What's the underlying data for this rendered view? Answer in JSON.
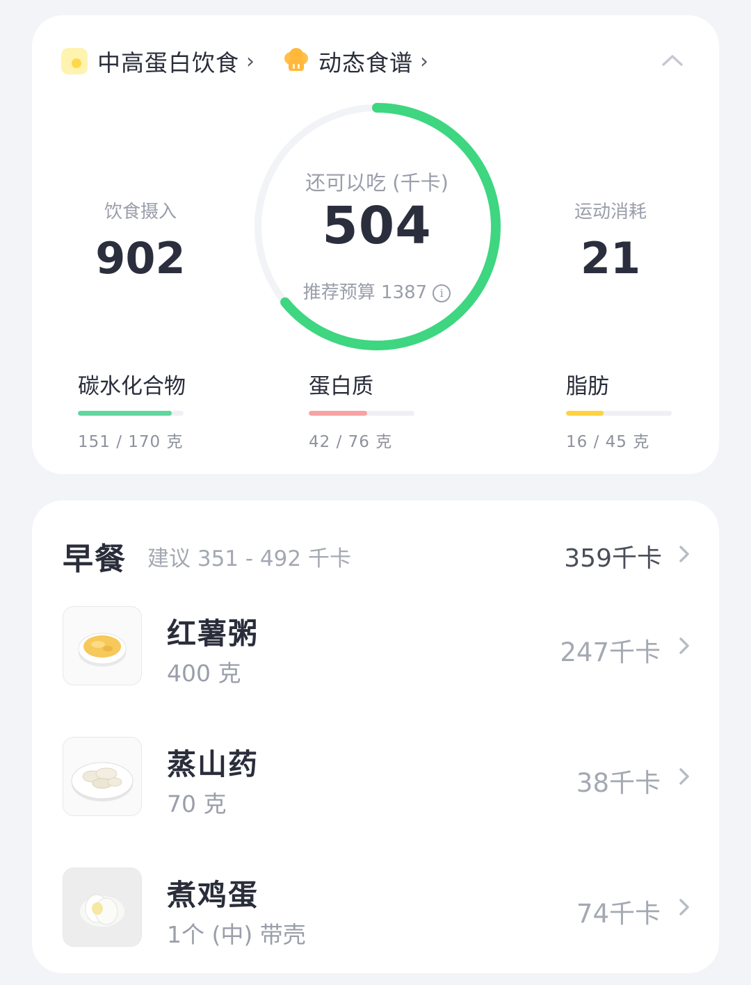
{
  "header": {
    "diet_label": "中高蛋白饮食",
    "recipe_label": "动态食谱",
    "chevron": "›"
  },
  "calories": {
    "intake_label": "饮食摄入",
    "intake_value": "902",
    "remaining_label": "还可以吃 (千卡)",
    "remaining_value": "504",
    "budget_text": "推荐预算 1387",
    "info_glyph": "i",
    "burn_label": "运动消耗",
    "burn_value": "21",
    "ring_progress": 0.64,
    "ring_color": "#3ed680",
    "ring_track_color": "#f2f3f6"
  },
  "macros": [
    {
      "name": "碳水化合物",
      "amount": "151 / 170 克",
      "progress": 0.888,
      "color": "#5fd79e"
    },
    {
      "name": "蛋白质",
      "amount": "42 / 76 克",
      "progress": 0.553,
      "color": "#f7a3a3"
    },
    {
      "name": "脂肪",
      "amount": "16 / 45 克",
      "progress": 0.356,
      "color": "#ffd23f"
    }
  ],
  "meal": {
    "title": "早餐",
    "range": "建议 351 - 492 千卡",
    "total": "359千卡",
    "items": [
      {
        "name": "红薯粥",
        "qty": "400 克",
        "kcal": "247千卡",
        "icon": "congee-bowl-icon"
      },
      {
        "name": "蒸山药",
        "qty": "70 克",
        "kcal": "38千卡",
        "icon": "yam-plate-icon"
      },
      {
        "name": "煮鸡蛋",
        "qty": "1个 (中) 带壳",
        "kcal": "74千卡",
        "icon": "boiled-egg-icon"
      }
    ]
  }
}
